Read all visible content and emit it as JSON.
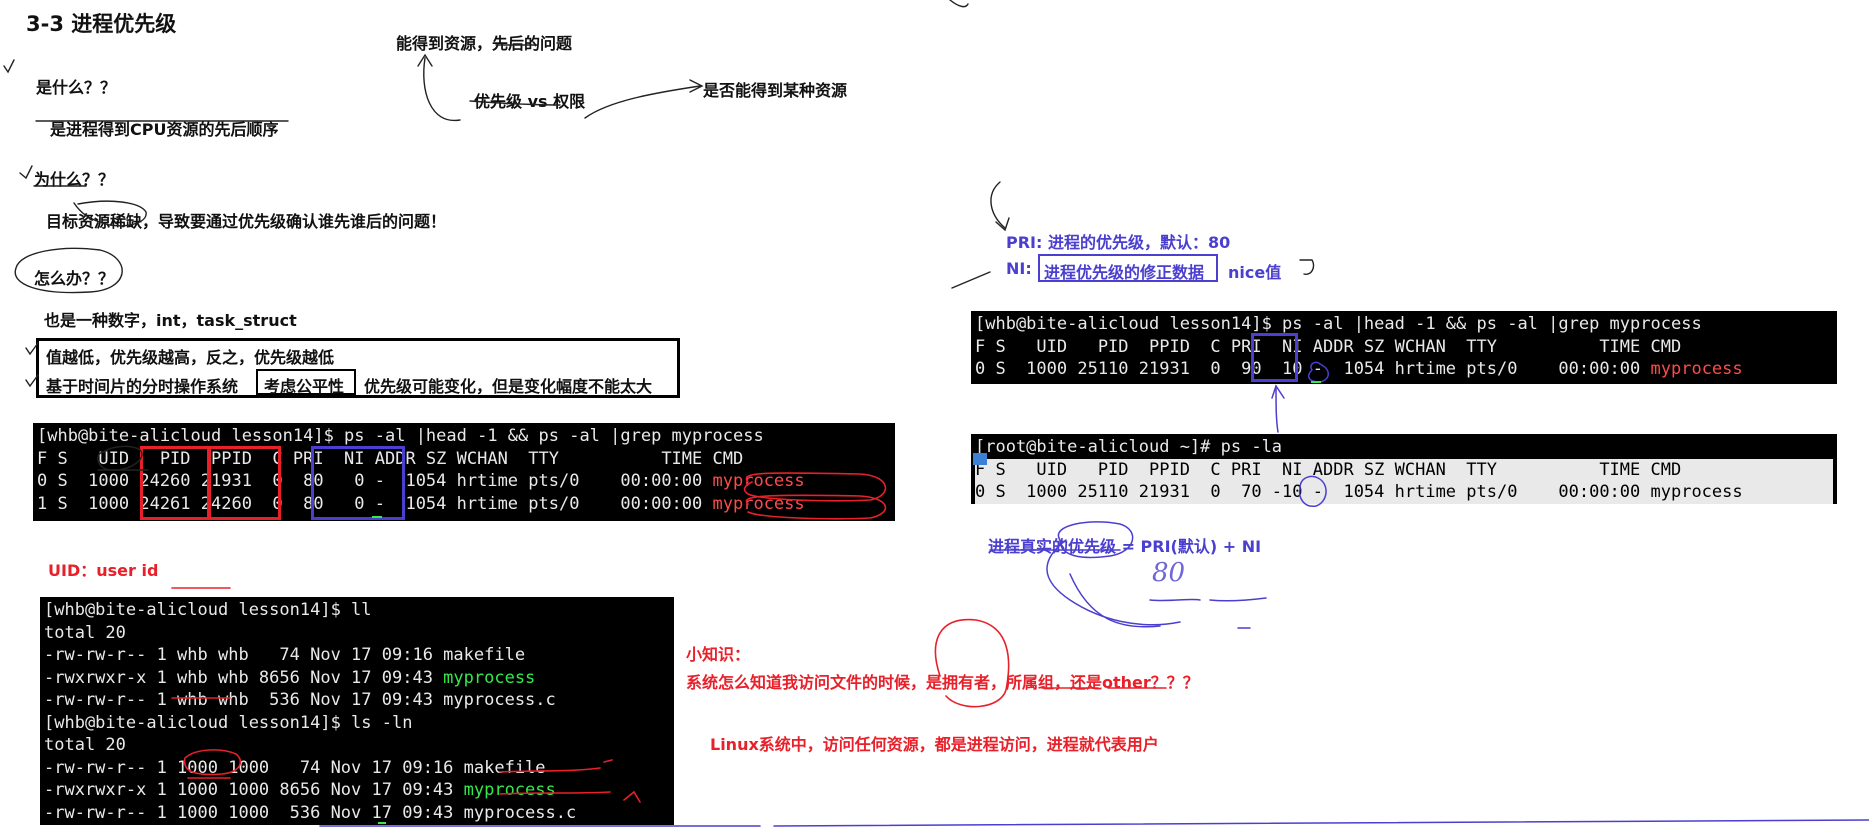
{
  "title": "3-3 进程优先级",
  "top_notes": {
    "resource_order": "能得到资源，先后的问题",
    "priority_vs_permission": "优先级 vs 权限",
    "can_get_resource": "是否能得到某种资源"
  },
  "left_notes": {
    "q_what": "是什么？？",
    "a_what": "是进程得到CPU资源的先后顺序",
    "q_why": "为什么？？",
    "a_why": "目标资源稀缺，导致要通过优先级确认谁先谁后的问题！",
    "q_how": "怎么办？？",
    "a_how": "也是一种数字，int，task_struct",
    "rule_lower": "值越低，优先级越高，反之，优先级越低",
    "rule_timeshare_a": "基于时间片的分时操作系统",
    "rule_timeshare_b": "考虑公平性",
    "rule_timeshare_c": "优先级可能变化，但是变化幅度不能太大"
  },
  "term_ps_left": {
    "lines": [
      "[whb@bite-alicloud lesson14]$ ps -al |head -1 && ps -al |grep myprocess",
      "F S   UID   PID  PPID  C PRI  NI ADDR SZ WCHAN  TTY          TIME CMD"
    ],
    "rows": [
      {
        "pre": "0 S  1000 24260 21931  0  80   0 -  1054 hrtime pts/0    00:00:00 ",
        "cmd": "myprocess"
      },
      {
        "pre": "1 S  1000 24261 24260  0  80   0 -  1054 hrtime pts/0    00:00:00 ",
        "cmd": "myprocess"
      }
    ]
  },
  "uid_label": "UID：user id",
  "term_ll": {
    "prompt1": "[whb@bite-alicloud lesson14]$ ll",
    "total1": "total 20",
    "files1": [
      {
        "pre": "-rw-rw-r-- 1 whb whb   74 Nov 17 09:16 ",
        "name": "makefile",
        "exec": false
      },
      {
        "pre": "-rwxrwxr-x 1 whb whb 8656 Nov 17 09:43 ",
        "name": "myprocess",
        "exec": true
      },
      {
        "pre": "-rw-rw-r-- 1 whb whb  536 Nov 17 09:43 ",
        "name": "myprocess.c",
        "exec": false
      }
    ],
    "prompt2": "[whb@bite-alicloud lesson14]$ ls -ln",
    "total2": "total 20",
    "files2": [
      {
        "pre": "-rw-rw-r-- 1 1000 1000   74 Nov 17 09:16 ",
        "name": "makefile",
        "exec": false
      },
      {
        "pre": "-rwxrwxr-x 1 1000 1000 8656 Nov 17 09:43 ",
        "name": "myprocess",
        "exec": true
      },
      {
        "pre": "-rw-rw-r-- 1 1000 1000  536 Nov 17 09:43 ",
        "name": "myprocess.c",
        "exec": false
      }
    ]
  },
  "tips": {
    "title": "小知识：",
    "question": "系统怎么知道我访问文件的时候，是拥有者，所属组，还是other？？？",
    "linux": "Linux系统中，访问任何资源，都是进程访问，进程就代表用户"
  },
  "right_notes": {
    "pri_def": "PRI: 进程的优先级，默认：80",
    "ni_label": "NI:",
    "ni_def": "进程优先级的修正数据",
    "ni_nice": "nice值",
    "formula": "进程真实的优先级 = PRI(默认) + NI",
    "handwritten_80": "80"
  },
  "term_ps_right1": {
    "cmd": "[whb@bite-alicloud lesson14]$ ps -al |head -1 && ps -al |grep myprocess",
    "header": "F S   UID   PID  PPID  C PRI  NI ADDR SZ WCHAN  TTY          TIME CMD",
    "row_pre": "0 S  1000 25110 21931  0  90  10 -  1054 hrtime pts/0    00:00:00 ",
    "row_cmd": "myprocess"
  },
  "term_ps_right2": {
    "cmd": "[root@bite-alicloud ~]# ps -la",
    "header": "F S   UID   PID  PPID  C PRI  NI ADDR SZ WCHAN  TTY          TIME CMD",
    "row": "0 S  1000 25110 21931  0  70 -10 -  1054 hrtime pts/0    00:00:00 myprocess"
  },
  "colors": {
    "annotation_blue": "#4b3fcf",
    "annotation_red": "#e8202a",
    "terminal_bg": "#000000",
    "exec_green": "#33e94b",
    "cmd_red": "#ff4a4a"
  }
}
